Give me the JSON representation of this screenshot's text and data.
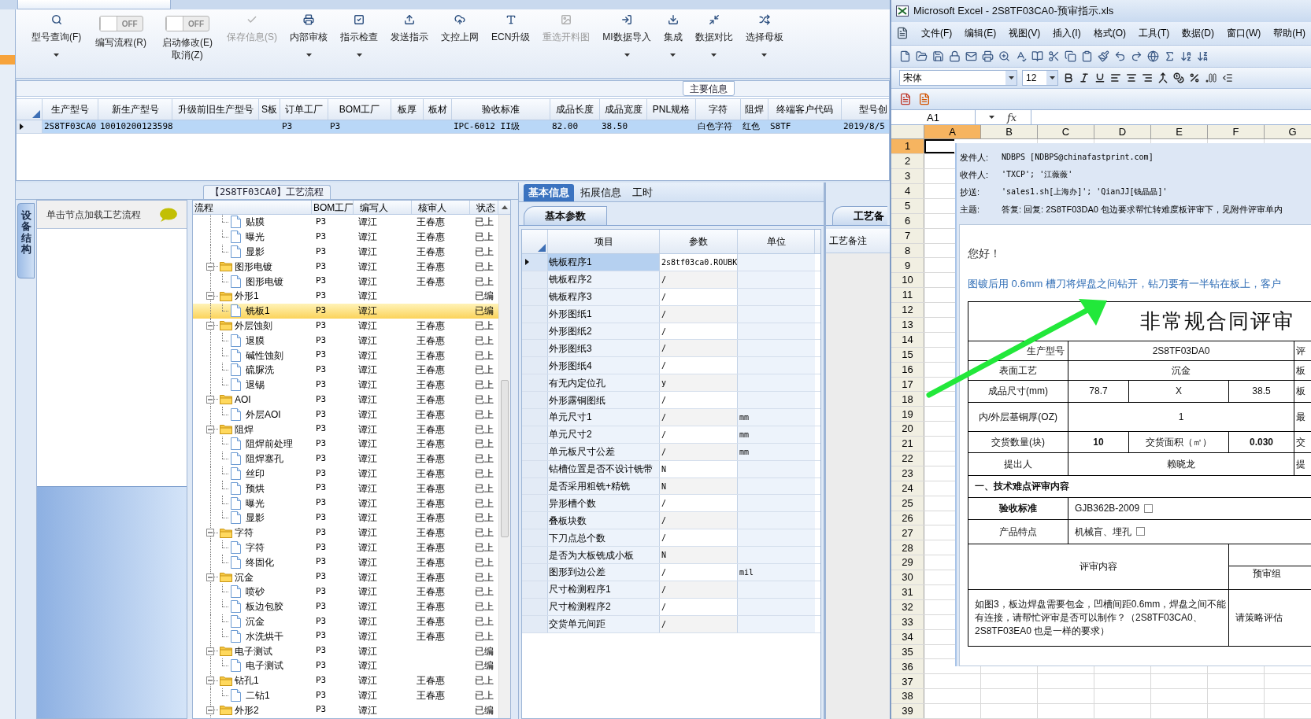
{
  "toolbar": [
    {
      "kind": "button",
      "label": "型号查询(F)",
      "disabled": false,
      "dropdown": true
    },
    {
      "kind": "toggle",
      "text": "OFF",
      "on": false,
      "label": "编写流程(R)"
    },
    {
      "kind": "toggle",
      "text": "OFF",
      "on": false,
      "label": "启动修改(E)",
      "label2": "取消(Z)"
    },
    {
      "kind": "button",
      "label": "保存信息(S)",
      "disabled": true,
      "dropdown": false
    },
    {
      "kind": "button",
      "label": "内部审核",
      "disabled": false,
      "dropdown": true
    },
    {
      "kind": "button",
      "label": "指示检查",
      "disabled": false,
      "dropdown": true
    },
    {
      "kind": "button",
      "label": "发送指示",
      "disabled": false,
      "dropdown": false
    },
    {
      "kind": "button",
      "label": "文控上网",
      "disabled": false,
      "dropdown": false
    },
    {
      "kind": "button",
      "label": "ECN升级",
      "disabled": false,
      "dropdown": false
    },
    {
      "kind": "button",
      "label": "重选开料图",
      "disabled": true,
      "dropdown": false
    },
    {
      "kind": "button",
      "label": "MI数据导入",
      "disabled": false,
      "dropdown": true
    },
    {
      "kind": "button",
      "label": "集成",
      "disabled": false,
      "dropdown": true
    },
    {
      "kind": "button",
      "label": "数据对比",
      "disabled": false,
      "dropdown": true
    },
    {
      "kind": "button",
      "label": "选择母板",
      "disabled": false,
      "dropdown": true
    }
  ],
  "main_info": {
    "title": "主要信息",
    "columns": [
      "生产型号",
      "新生产型号",
      "升级前旧生产型号",
      "S板",
      "订单工厂",
      "BOM工厂",
      "板厚",
      "板材",
      "验收标准",
      "成品长度",
      "成品宽度",
      "PNL规格",
      "字符",
      "阻焊",
      "终端客户代码",
      "型号创"
    ],
    "rows": [
      {
        "selected": true,
        "cells": [
          "2S8TF03CA0",
          "10010200123598",
          null,
          null,
          "P3",
          "P3",
          null,
          null,
          "IPC-6012 II级",
          "82.00",
          "38.50",
          null,
          "白色字符",
          "红色",
          "S8TF",
          "2019/8/5"
        ]
      }
    ]
  },
  "process": {
    "title": "【2S8TF03CA0】工艺流程",
    "side_tab": "设备结构",
    "side_header": "单击节点加载工艺流程",
    "columns": [
      "流程",
      "BOM工厂",
      "编写人",
      "核审人",
      "状态"
    ],
    "tree": [
      {
        "children": [
          {
            "kind": "step",
            "label": "贴膜",
            "factory": "P3",
            "writer": "谭江",
            "reviewer": "王春惠",
            "status": "已上",
            "selected": false
          },
          {
            "kind": "step",
            "label": "曝光",
            "factory": "P3",
            "writer": "谭江",
            "reviewer": "王春惠",
            "status": "已上",
            "selected": false
          },
          {
            "kind": "step",
            "label": "显影",
            "factory": "P3",
            "writer": "谭江",
            "reviewer": "王春惠",
            "status": "已上",
            "selected": false
          }
        ]
      },
      {
        "kind": "group",
        "label": "图形电镀",
        "factory": "P3",
        "writer": "谭江",
        "reviewer": "王春惠",
        "status": "已上",
        "selected": false,
        "expanded": true,
        "children": [
          {
            "kind": "step",
            "label": "图形电镀",
            "factory": "P3",
            "writer": "谭江",
            "reviewer": "王春惠",
            "status": "已上",
            "selected": false
          }
        ]
      },
      {
        "kind": "group",
        "label": "外形1",
        "factory": "P3",
        "writer": "谭江",
        "status": "已编",
        "selected": false,
        "expanded": true,
        "children": [
          {
            "kind": "step",
            "label": "铣板1",
            "factory": "P3",
            "writer": "谭江",
            "status": "已编",
            "selected": true
          }
        ]
      },
      {
        "kind": "group",
        "label": "外层蚀刻",
        "factory": "P3",
        "writer": "谭江",
        "reviewer": "王春惠",
        "status": "已上",
        "selected": false,
        "expanded": true,
        "children": [
          {
            "kind": "step",
            "label": "退膜",
            "factory": "P3",
            "writer": "谭江",
            "reviewer": "王春惠",
            "status": "已上",
            "selected": false
          },
          {
            "kind": "step",
            "label": "碱性蚀刻",
            "factory": "P3",
            "writer": "谭江",
            "reviewer": "王春惠",
            "status": "已上",
            "selected": false
          },
          {
            "kind": "step",
            "label": "硫脲洗",
            "factory": "P3",
            "writer": "谭江",
            "reviewer": "王春惠",
            "status": "已上",
            "selected": false
          },
          {
            "kind": "step",
            "label": "退锡",
            "factory": "P3",
            "writer": "谭江",
            "reviewer": "王春惠",
            "status": "已上",
            "selected": false
          }
        ]
      },
      {
        "kind": "group",
        "label": "AOI",
        "factory": "P3",
        "writer": "谭江",
        "reviewer": "王春惠",
        "status": "已上",
        "selected": false,
        "expanded": true,
        "children": [
          {
            "kind": "step",
            "label": "外层AOI",
            "factory": "P3",
            "writer": "谭江",
            "reviewer": "王春惠",
            "status": "已上",
            "selected": false
          }
        ]
      },
      {
        "kind": "group",
        "label": "阻焊",
        "factory": "P3",
        "writer": "谭江",
        "reviewer": "王春惠",
        "status": "已上",
        "selected": false,
        "expanded": true,
        "children": [
          {
            "kind": "step",
            "label": "阻焊前处理",
            "factory": "P3",
            "writer": "谭江",
            "reviewer": "王春惠",
            "status": "已上",
            "selected": false
          },
          {
            "kind": "step",
            "label": "阻焊塞孔",
            "factory": "P3",
            "writer": "谭江",
            "reviewer": "王春惠",
            "status": "已上",
            "selected": false
          },
          {
            "kind": "step",
            "label": "丝印",
            "factory": "P3",
            "writer": "谭江",
            "reviewer": "王春惠",
            "status": "已上",
            "selected": false
          },
          {
            "kind": "step",
            "label": "预烘",
            "factory": "P3",
            "writer": "谭江",
            "reviewer": "王春惠",
            "status": "已上",
            "selected": false
          },
          {
            "kind": "step",
            "label": "曝光",
            "factory": "P3",
            "writer": "谭江",
            "reviewer": "王春惠",
            "status": "已上",
            "selected": false
          },
          {
            "kind": "step",
            "label": "显影",
            "factory": "P3",
            "writer": "谭江",
            "reviewer": "王春惠",
            "status": "已上",
            "selected": false
          }
        ]
      },
      {
        "kind": "group",
        "label": "字符",
        "factory": "P3",
        "writer": "谭江",
        "reviewer": "王春惠",
        "status": "已上",
        "selected": false,
        "expanded": true,
        "children": [
          {
            "kind": "step",
            "label": "字符",
            "factory": "P3",
            "writer": "谭江",
            "reviewer": "王春惠",
            "status": "已上",
            "selected": false
          },
          {
            "kind": "step",
            "label": "终固化",
            "factory": "P3",
            "writer": "谭江",
            "reviewer": "王春惠",
            "status": "已上",
            "selected": false
          }
        ]
      },
      {
        "kind": "group",
        "label": "沉金",
        "factory": "P3",
        "writer": "谭江",
        "reviewer": "王春惠",
        "status": "已上",
        "selected": false,
        "expanded": true,
        "children": [
          {
            "kind": "step",
            "label": "喷砂",
            "factory": "P3",
            "writer": "谭江",
            "reviewer": "王春惠",
            "status": "已上",
            "selected": false
          },
          {
            "kind": "step",
            "label": "板边包胶",
            "factory": "P3",
            "writer": "谭江",
            "reviewer": "王春惠",
            "status": "已上",
            "selected": false
          },
          {
            "kind": "step",
            "label": "沉金",
            "factory": "P3",
            "writer": "谭江",
            "reviewer": "王春惠",
            "status": "已上",
            "selected": false
          },
          {
            "kind": "step",
            "label": "水洗烘干",
            "factory": "P3",
            "writer": "谭江",
            "reviewer": "王春惠",
            "status": "已上",
            "selected": false
          }
        ]
      },
      {
        "kind": "group",
        "label": "电子测试",
        "factory": "P3",
        "writer": "谭江",
        "status": "已编",
        "selected": false,
        "expanded": true,
        "children": [
          {
            "kind": "step",
            "label": "电子测试",
            "factory": "P3",
            "writer": "谭江",
            "status": "已编",
            "selected": false
          }
        ]
      },
      {
        "kind": "group",
        "label": "钻孔1",
        "factory": "P3",
        "writer": "谭江",
        "reviewer": "王春惠",
        "status": "已上",
        "selected": false,
        "expanded": true,
        "children": [
          {
            "kind": "step",
            "label": "二钻1",
            "factory": "P3",
            "writer": "谭江",
            "reviewer": "王春惠",
            "status": "已上",
            "selected": false
          }
        ]
      },
      {
        "kind": "group",
        "label": "外形2",
        "factory": "P3",
        "writer": "谭江",
        "status": "已编",
        "selected": false,
        "expanded": true
      }
    ]
  },
  "params": {
    "tabs": [
      {
        "label": "基本信息",
        "selected": true
      },
      {
        "label": "拓展信息",
        "selected": false
      },
      {
        "label": "工时",
        "selected": false
      }
    ],
    "sub_tab": "基本参数",
    "columns": [
      "项目",
      "参数",
      "单位"
    ],
    "rows": [
      {
        "item": "铣板程序1",
        "value": "2s8tf03ca0.ROUBK",
        "selected": true
      },
      {
        "item": "铣板程序2",
        "value": "/",
        "selected": false
      },
      {
        "item": "铣板程序3",
        "value": "/",
        "selected": false
      },
      {
        "item": "外形图纸1",
        "value": "/",
        "selected": false
      },
      {
        "item": "外形图纸2",
        "value": "/",
        "selected": false
      },
      {
        "item": "外形图纸3",
        "value": "/",
        "selected": false
      },
      {
        "item": "外形图纸4",
        "value": "/",
        "selected": false
      },
      {
        "item": "有无内定位孔",
        "value": "y",
        "selected": false
      },
      {
        "item": "外形露铜图纸",
        "value": "/",
        "selected": false
      },
      {
        "item": "单元尺寸1",
        "value": "/",
        "unit": "mm",
        "selected": false
      },
      {
        "item": "单元尺寸2",
        "value": "/",
        "unit": "mm",
        "selected": false
      },
      {
        "item": "单元板尺寸公差",
        "value": "/",
        "unit": "mm",
        "selected": false
      },
      {
        "item": "钻槽位置是否不设计铣带",
        "value": "N",
        "selected": false
      },
      {
        "item": "是否采用粗铣+精铣",
        "value": "N",
        "selected": false
      },
      {
        "item": "异形槽个数",
        "value": "/",
        "selected": false
      },
      {
        "item": "叠板块数",
        "value": "/",
        "selected": false
      },
      {
        "item": "下刀点总个数",
        "value": "/",
        "selected": false
      },
      {
        "item": "是否为大板铣成小板",
        "value": "N",
        "selected": false
      },
      {
        "item": "图形到边公差",
        "value": "/",
        "unit": "mil",
        "selected": false
      },
      {
        "item": "尺寸检测程序1",
        "value": "/",
        "selected": false
      },
      {
        "item": "尺寸检测程序2",
        "value": "/",
        "selected": false
      },
      {
        "item": "交货单元间距",
        "value": "/",
        "selected": false
      }
    ]
  },
  "notes": {
    "tab": "工艺备",
    "column": "工艺备注"
  },
  "excel": {
    "title": "Microsoft Excel - 2S8TF03CA0-预审指示.xls",
    "menu": [
      "文件(F)",
      "编辑(E)",
      "视图(V)",
      "插入(I)",
      "格式(O)",
      "工具(T)",
      "数据(D)",
      "窗口(W)",
      "帮助(H)"
    ],
    "font": "宋体",
    "size": "12",
    "name_box": "A1",
    "fx": "fx",
    "columns": [
      {
        "label": "A",
        "selected": true
      },
      {
        "label": "B",
        "selected": false
      },
      {
        "label": "C",
        "selected": false
      },
      {
        "label": "D",
        "selected": false
      },
      {
        "label": "E",
        "selected": false
      },
      {
        "label": "F",
        "selected": false
      },
      {
        "label": "G",
        "selected": false
      }
    ],
    "rows": [
      {
        "label": "1",
        "selected": true
      },
      {
        "label": "2",
        "selected": false
      },
      {
        "label": "3",
        "selected": false
      },
      {
        "label": "4",
        "selected": false
      },
      {
        "label": "5",
        "selected": false
      },
      {
        "label": "6",
        "selected": false
      },
      {
        "label": "7",
        "selected": false
      },
      {
        "label": "8",
        "selected": false
      },
      {
        "label": "9",
        "selected": false
      },
      {
        "label": "10",
        "selected": false
      },
      {
        "label": "11",
        "selected": false
      },
      {
        "label": "12",
        "selected": false
      },
      {
        "label": "13",
        "selected": false
      },
      {
        "label": "14",
        "selected": false
      },
      {
        "label": "15",
        "selected": false
      },
      {
        "label": "16",
        "selected": false
      },
      {
        "label": "17",
        "selected": false
      },
      {
        "label": "18",
        "selected": false
      },
      {
        "label": "19",
        "selected": false
      },
      {
        "label": "20",
        "selected": false
      },
      {
        "label": "21",
        "selected": false
      },
      {
        "label": "22",
        "selected": false
      },
      {
        "label": "23",
        "selected": false
      },
      {
        "label": "24",
        "selected": false
      },
      {
        "label": "25",
        "selected": false
      },
      {
        "label": "26",
        "selected": false
      },
      {
        "label": "27",
        "selected": false
      },
      {
        "label": "28",
        "selected": false
      },
      {
        "label": "29",
        "selected": false
      },
      {
        "label": "30",
        "selected": false
      },
      {
        "label": "31",
        "selected": false
      },
      {
        "label": "32",
        "selected": false
      },
      {
        "label": "33",
        "selected": false
      },
      {
        "label": "34",
        "selected": false
      },
      {
        "label": "35",
        "selected": false
      },
      {
        "label": "36",
        "selected": false
      },
      {
        "label": "37",
        "selected": false
      },
      {
        "label": "38",
        "selected": false
      },
      {
        "label": "39",
        "selected": false
      }
    ],
    "email": {
      "fields": [
        {
          "label": "发件人:",
          "value": "NDBPS [NDBPS@chinafastprint.com]"
        },
        {
          "label": "收件人:",
          "value": "'TXCP'; '江薇薇'"
        },
        {
          "label": "抄送:",
          "value": "'sales1.sh[上海办]'; 'QianJJ[钱晶晶]'"
        },
        {
          "label": "主题:",
          "value": "答复: 回复: 2S8TF03DA0 包边要求帮忙转难度板评审下，见附件评审单内"
        }
      ],
      "greeting": "您好！",
      "body": "图镀后用 0.6mm 槽刀将焊盘之间钻开，钻刀要有一半钻在板上，客户",
      "form_title": "非常规合同评审",
      "form_rows": [
        {
          "kind": "pair",
          "cells": [
            {
              "text": "生产型号"
            },
            {
              "text": "2S8TF03DA0"
            },
            {
              "text": "评"
            }
          ]
        },
        {
          "kind": "pair",
          "cells": [
            {
              "text": "表面工艺"
            },
            {
              "text": "沉金"
            },
            {
              "text": "板"
            }
          ]
        },
        {
          "kind": "quad",
          "cells": [
            {
              "text": "成品尺寸(mm)"
            },
            {
              "text": "78.7"
            },
            {
              "text": "X"
            },
            {
              "text": "38.5"
            },
            {
              "text": "板"
            }
          ]
        },
        {
          "kind": "pair",
          "cells": [
            {
              "text": "内/外层基铜厚(OZ)"
            },
            {
              "text": "1"
            },
            {
              "text": "最"
            }
          ]
        },
        {
          "kind": "quad",
          "cells": [
            {
              "text": "交货数量(块)",
              "bold": false
            },
            {
              "text": "10",
              "bold": true
            },
            {
              "text": "交货面积（㎡）",
              "bold": false
            },
            {
              "text": "0.030",
              "bold": true
            },
            {
              "text": "交",
              "bold": false
            }
          ]
        },
        {
          "kind": "pair",
          "cells": [
            {
              "text": "提出人"
            },
            {
              "text": "赖晓龙"
            },
            {
              "text": "提"
            }
          ]
        },
        {
          "kind": "section",
          "cells": [
            {
              "text": "一、技术难点评审内容",
              "bold": true
            }
          ]
        },
        {
          "kind": "check",
          "cells": [
            {
              "text": "验收标准",
              "bold": true
            },
            {
              "text": "GJB362B-2009",
              "checked": false
            }
          ]
        },
        {
          "kind": "check",
          "cells": [
            {
              "text": "产品特点",
              "bold": false
            },
            {
              "text": "机械盲、埋孔",
              "checked": false
            }
          ]
        },
        {
          "kind": "review_head",
          "cells": [
            {
              "text": "评审内容"
            },
            {
              "text": "预审组"
            }
          ]
        },
        {
          "kind": "review_body",
          "cells": [
            {
              "text": "如图3，板边焊盘需要包金，凹槽间距0.6mm，焊盘之间不能有连接，请帮忙评审是否可以制作？（2S8TF03CA0、2S8TF03EA0 也是一样的要求）"
            },
            {
              "text": "请策略评估"
            }
          ]
        }
      ]
    }
  }
}
